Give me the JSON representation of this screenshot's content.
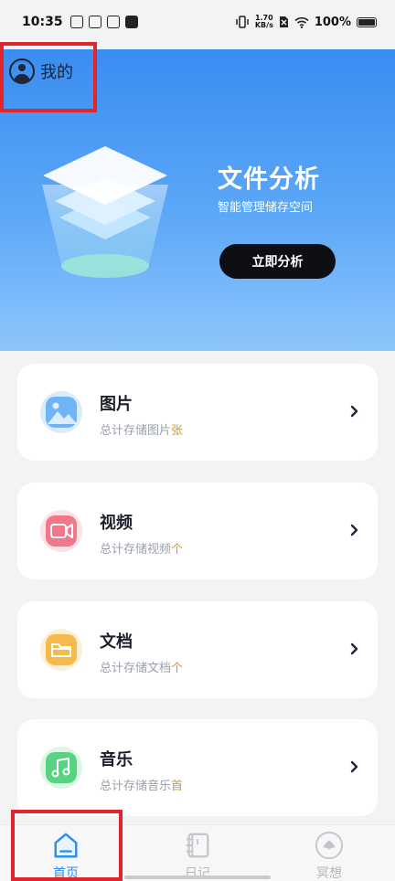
{
  "status_bar": {
    "time": "10:35",
    "net_speed_value": "1.70",
    "net_speed_unit": "KB/s",
    "battery": "100%"
  },
  "header": {
    "profile_label": "我的"
  },
  "hero": {
    "title": "文件分析",
    "subtitle": "智能管理储存空间",
    "button_label": "立即分析"
  },
  "categories": [
    {
      "title": "图片",
      "subtitle": "总计存储图片",
      "unit": "张",
      "icon": "image-icon",
      "color": "#5fa8f2"
    },
    {
      "title": "视频",
      "subtitle": "总计存储视频",
      "unit": "个",
      "icon": "video-icon",
      "color": "#f06b7c"
    },
    {
      "title": "文档",
      "subtitle": "总计存储文档",
      "unit": "个",
      "icon": "folder-icon",
      "color": "#f2b544"
    },
    {
      "title": "音乐",
      "subtitle": "总计存储音乐",
      "unit": "首",
      "icon": "music-icon",
      "color": "#4fcf7a"
    }
  ],
  "bottom_nav": {
    "items": [
      {
        "label": "首页",
        "icon": "home-icon",
        "active": true
      },
      {
        "label": "日记",
        "icon": "diary-icon",
        "active": false
      },
      {
        "label": "冥想",
        "icon": "meditation-icon",
        "active": false
      }
    ]
  },
  "colors": {
    "accent": "#2d8ef0",
    "highlight": "#e0262c",
    "unit": "#d39a24"
  }
}
